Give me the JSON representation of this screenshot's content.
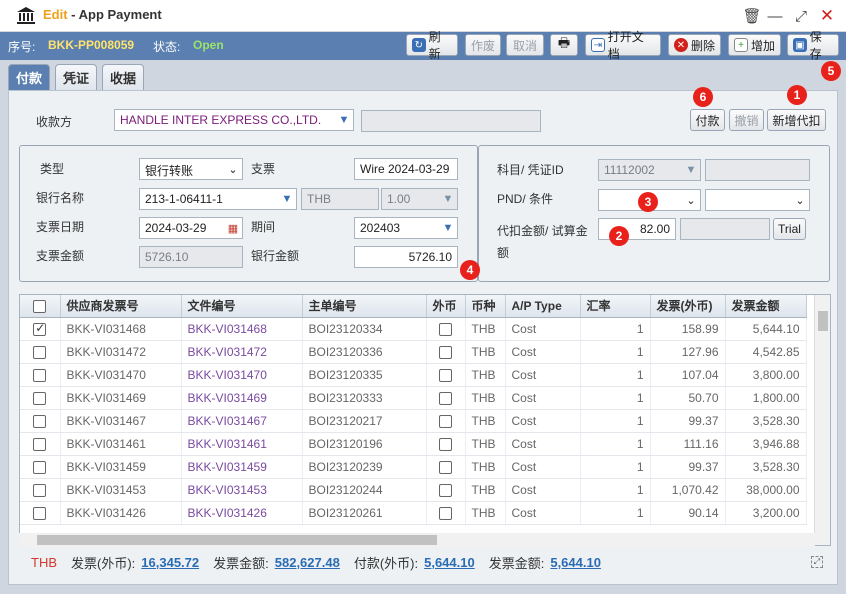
{
  "window": {
    "edit_label": "Edit",
    "title": " - App Payment"
  },
  "info": {
    "doc_no_label": "序号:",
    "doc_no": "BKK-PP008059",
    "status_label": "状态:",
    "status": "Open"
  },
  "toolbar": {
    "refresh": "刷新",
    "void": "作废",
    "cancel": "取消",
    "open_doc": "打开文档",
    "delete": "删除",
    "add": "增加",
    "save": "保存"
  },
  "tabs": [
    "付款",
    "凭证",
    "收据"
  ],
  "payee": {
    "label": "收款方",
    "value": "HANDLE INTER EXPRESS CO.,LTD.",
    "extra": ""
  },
  "actions": {
    "pay": "付款",
    "undo": "撤销",
    "new_agent": "新增代扣"
  },
  "left_form": {
    "type_label": "类型",
    "type_value": "银行转账",
    "cheque_label": "支票",
    "cheque_value": "Wire 2024-03-29",
    "bank_label": "银行名称",
    "bank_value": "213-1-06411-1",
    "currency": "THB",
    "rate": "1.00",
    "cheque_date_label": "支票日期",
    "cheque_date": "2024-03-29",
    "period_label": "期间",
    "period_value": "202403",
    "cheque_amount_label": "支票金额",
    "cheque_amount": "5726.10",
    "bank_amount_label": "银行金额",
    "bank_amount": "5726.10"
  },
  "right_form": {
    "account_label": "科目/ 凭证ID",
    "account_value": "11112002",
    "account_extra": "",
    "pnd_label": "PND/ 条件",
    "pnd_value": "",
    "cond_value": "",
    "withhold_label": "代扣金额/ 试算金额",
    "withhold_value": "82.00",
    "trial_value": "",
    "trial_button": "Trial"
  },
  "badges": [
    "1",
    "2",
    "3",
    "4",
    "5",
    "6"
  ],
  "grid": {
    "columns": [
      "",
      "供应商发票号",
      "文件编号",
      "主单编号",
      "外币",
      "币种",
      "A/P Type",
      "汇率",
      "发票(外币)",
      "发票金额"
    ],
    "rows": [
      {
        "checked": true,
        "vendor_inv": "BKK-VI031468",
        "file_no": "BKK-VI031468",
        "master_no": "BOI23120334",
        "fx": false,
        "cur": "THB",
        "ap_type": "Cost",
        "rate": "1",
        "inv_fx": "158.99",
        "inv_amt": "5,644.10"
      },
      {
        "checked": false,
        "vendor_inv": "BKK-VI031472",
        "file_no": "BKK-VI031472",
        "master_no": "BOI23120336",
        "fx": false,
        "cur": "THB",
        "ap_type": "Cost",
        "rate": "1",
        "inv_fx": "127.96",
        "inv_amt": "4,542.85"
      },
      {
        "checked": false,
        "vendor_inv": "BKK-VI031470",
        "file_no": "BKK-VI031470",
        "master_no": "BOI23120335",
        "fx": false,
        "cur": "THB",
        "ap_type": "Cost",
        "rate": "1",
        "inv_fx": "107.04",
        "inv_amt": "3,800.00"
      },
      {
        "checked": false,
        "vendor_inv": "BKK-VI031469",
        "file_no": "BKK-VI031469",
        "master_no": "BOI23120333",
        "fx": false,
        "cur": "THB",
        "ap_type": "Cost",
        "rate": "1",
        "inv_fx": "50.70",
        "inv_amt": "1,800.00"
      },
      {
        "checked": false,
        "vendor_inv": "BKK-VI031467",
        "file_no": "BKK-VI031467",
        "master_no": "BOI23120217",
        "fx": false,
        "cur": "THB",
        "ap_type": "Cost",
        "rate": "1",
        "inv_fx": "99.37",
        "inv_amt": "3,528.30"
      },
      {
        "checked": false,
        "vendor_inv": "BKK-VI031461",
        "file_no": "BKK-VI031461",
        "master_no": "BOI23120196",
        "fx": false,
        "cur": "THB",
        "ap_type": "Cost",
        "rate": "1",
        "inv_fx": "111.16",
        "inv_amt": "3,946.88"
      },
      {
        "checked": false,
        "vendor_inv": "BKK-VI031459",
        "file_no": "BKK-VI031459",
        "master_no": "BOI23120239",
        "fx": false,
        "cur": "THB",
        "ap_type": "Cost",
        "rate": "1",
        "inv_fx": "99.37",
        "inv_amt": "3,528.30"
      },
      {
        "checked": false,
        "vendor_inv": "BKK-VI031453",
        "file_no": "BKK-VI031453",
        "master_no": "BOI23120244",
        "fx": false,
        "cur": "THB",
        "ap_type": "Cost",
        "rate": "1",
        "inv_fx": "1,070.42",
        "inv_amt": "38,000.00"
      },
      {
        "checked": false,
        "vendor_inv": "BKK-VI031426",
        "file_no": "BKK-VI031426",
        "master_no": "BOI23120261",
        "fx": false,
        "cur": "THB",
        "ap_type": "Cost",
        "rate": "1",
        "inv_fx": "90.14",
        "inv_amt": "3,200.00"
      }
    ]
  },
  "totals": {
    "currency": "THB",
    "inv_fx_label": "发票(外币):",
    "inv_fx": "16,345.72",
    "inv_amt_label": "发票金额:",
    "inv_amt": "582,627.48",
    "pay_fx_label": "付款(外币):",
    "pay_fx": "5,644.10",
    "pay_amt_label": "发票金额:",
    "pay_amt": "5,644.10"
  }
}
